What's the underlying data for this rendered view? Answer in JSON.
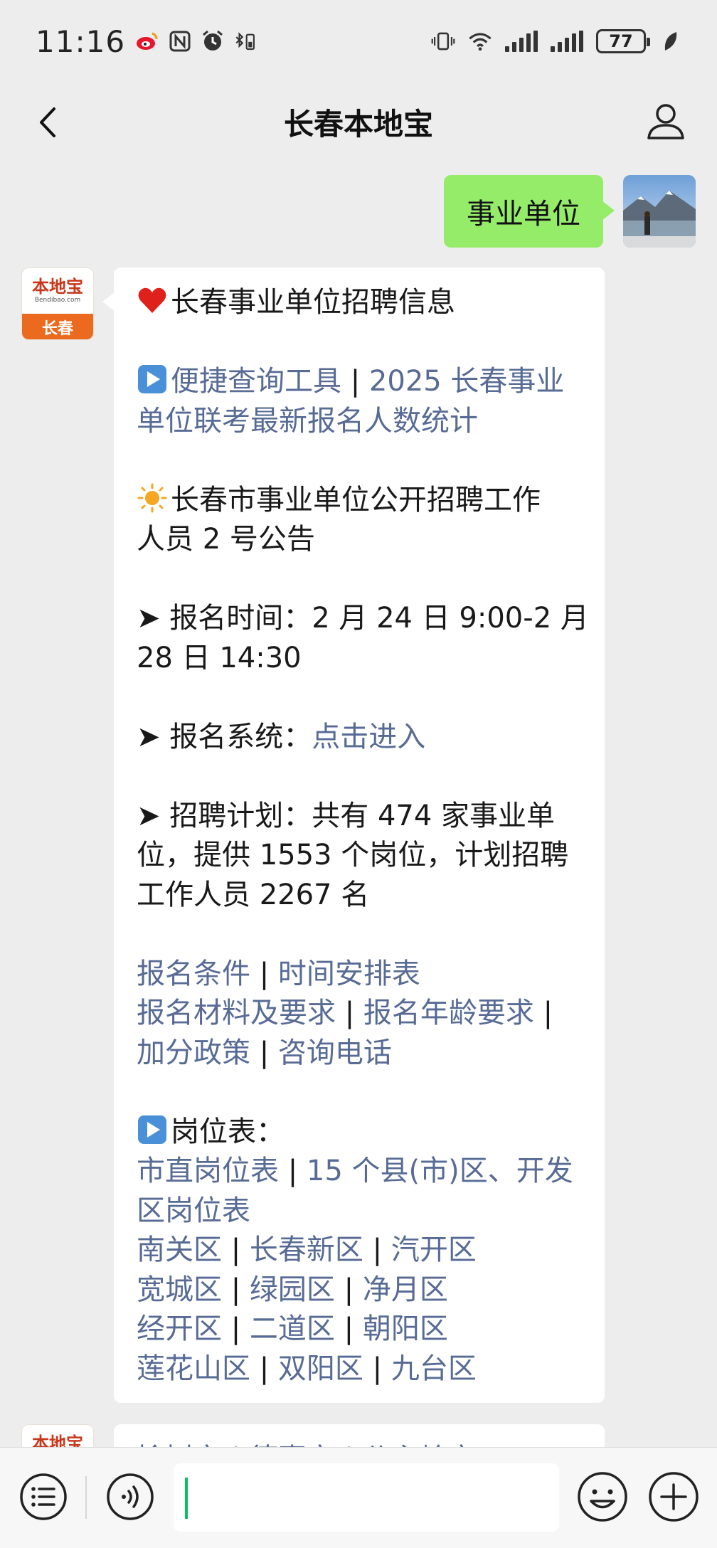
{
  "status_bar": {
    "time": "11:16",
    "battery": "77"
  },
  "header": {
    "title": "长春本地宝"
  },
  "messages": {
    "user_message": "事业单位",
    "bot_avatar": {
      "logo_text": "本地宝",
      "logo_url_text": "Bendibao.com",
      "city": "长春"
    },
    "bot_message": {
      "title": "长春事业单位招聘信息",
      "tool_prefix": "便捷查询工具",
      "tool_link_line1": "2025 长春事业",
      "tool_link_line2": "单位联考最新报名人数统计",
      "announcement_line1": "长春市事业单位公开招聘工作",
      "announcement_line2": "人员 2 号公告",
      "reg_time_line1": "➤ 报名时间：2 月 24 日 9:00-2 月",
      "reg_time_line2": "28 日 14:30",
      "reg_system_label": "➤ 报名系统：",
      "reg_system_link": "点击进入",
      "plan_line1": "➤ 招聘计划：共有 474 家事业单",
      "plan_line2": "位，提供 1553 个岗位，计划招聘",
      "plan_line3": "工作人员 2267 名",
      "links_row1": [
        "报名条件",
        "时间安排表"
      ],
      "links_row2": [
        "报名材料及要求",
        "报名年龄要求"
      ],
      "links_row3": [
        "加分政策",
        "咨询电话"
      ],
      "posts_label": "岗位表：",
      "posts_row1_a": "市直岗位表",
      "posts_row1_b": "15 个县(市)区、开发",
      "posts_row1_c": "区岗位表",
      "districts": [
        [
          "南关区",
          "长春新区",
          "汽开区"
        ],
        [
          "宽城区",
          "绿园区",
          "净月区"
        ],
        [
          "经开区",
          "二道区",
          "朝阳区"
        ],
        [
          "莲花山区",
          "双阳区",
          "九台区"
        ]
      ],
      "separator": "|"
    },
    "second_bot_partial": "榆树市 | 德惠市 | 公主岭市"
  },
  "colors": {
    "user_bubble": "#95ec69",
    "link": "#576b95",
    "chat_background": "#ededed",
    "input_cursor": "#07c160"
  },
  "icons": {
    "back": "chevron-left-icon",
    "profile": "person-icon",
    "menu": "list-icon",
    "voice": "voice-icon",
    "emoji": "smiley-icon",
    "plus": "plus-icon"
  }
}
